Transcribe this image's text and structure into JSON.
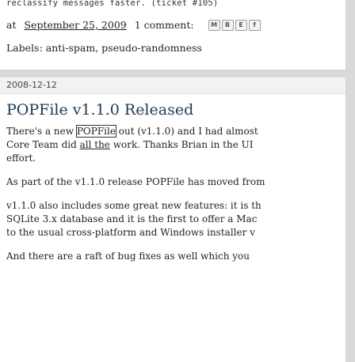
{
  "prev_post": {
    "snippet": "reclassify messages faster. (ticket #105)",
    "meta_prefix": "at",
    "date_link": "September 25, 2009",
    "comments": "1 comment:",
    "share_icons": [
      "M",
      "B",
      "E",
      "f"
    ],
    "labels_text": "Labels: anti-spam, pseudo-randomness"
  },
  "post": {
    "date": "2008-12-12",
    "title": "POPFile v1.1.0 Released",
    "p1": {
      "a": "There's a new ",
      "boxed": "POPFile",
      "b": " out (v1.1.0) and I had almost",
      "c": "Core Team did ",
      "ul": "all the",
      "d": " work. Thanks Brian in the UI",
      "e": "effort."
    },
    "p2": "As part of the v1.1.0 release POPFile has moved from",
    "p3a": "v1.1.0 also includes some great new features: it is th",
    "p3b": "SQLite 3.x database and it is the first to offer a Mac",
    "p3c": "to the usual cross-platform and Windows installer v",
    "p4": "And there are a raft of bug fixes as well which you"
  }
}
